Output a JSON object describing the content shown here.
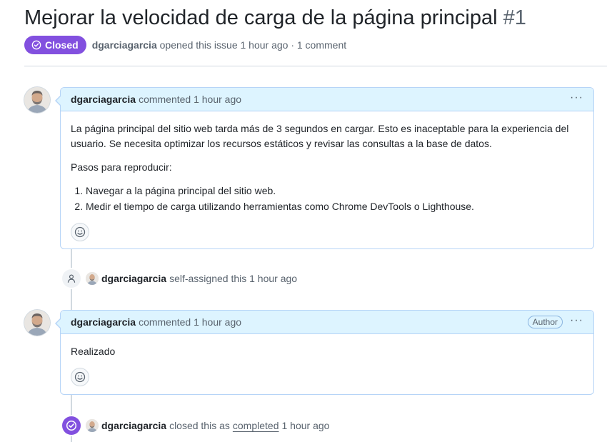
{
  "issue": {
    "title": "Mejorar la velocidad de carga de la página principal",
    "number": "#1",
    "state": "Closed",
    "author": "dgarciagarcia",
    "opened_text": "opened this issue 1 hour ago · 1 comment"
  },
  "comments": [
    {
      "author": "dgarciagarcia",
      "action": "commented 1 hour ago",
      "menu": "···",
      "paragraphs": [
        "La página principal del sitio web tarda más de 3 segundos en cargar. Esto es inaceptable para la experiencia del usuario. Se necesita optimizar los recursos estáticos y revisar las consultas a la base de datos.",
        "Pasos para reproducir:"
      ],
      "steps": [
        "Navegar a la página principal del sitio web.",
        "Medir el tiempo de carga utilizando herramientas como Chrome DevTools o Lighthouse."
      ]
    },
    {
      "author": "dgarciagarcia",
      "action": "commented 1 hour ago",
      "badge": "Author",
      "menu": "···",
      "text": "Realizado"
    }
  ],
  "events": {
    "assigned": {
      "icon": "person-icon",
      "user": "dgarciagarcia",
      "text": "self-assigned this 1 hour ago"
    },
    "closed": {
      "icon": "check-circle-icon",
      "user": "dgarciagarcia",
      "text_before": "closed this as",
      "link": "completed",
      "text_after": "1 hour ago"
    }
  },
  "colors": {
    "closed_purple": "#8250df",
    "header_blue": "#ddf4ff",
    "border_blue": "#b6d4f7"
  }
}
